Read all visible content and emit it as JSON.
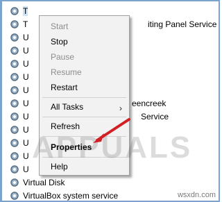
{
  "services": [
    {
      "label": "T",
      "selected": true
    },
    {
      "label": "T",
      "suffix": "iting Panel Service"
    },
    {
      "label": "U"
    },
    {
      "label": "U"
    },
    {
      "label": "U"
    },
    {
      "label": "U"
    },
    {
      "label": "U"
    },
    {
      "label": "U",
      "suffix": "eencreek"
    },
    {
      "label": "U",
      "suffix": "Service"
    },
    {
      "label": "U"
    },
    {
      "label": "U"
    },
    {
      "label": "U"
    },
    {
      "label": "U"
    },
    {
      "label": "Virtual Disk"
    },
    {
      "label": "VirtualBox system service"
    }
  ],
  "context_menu": {
    "start": "Start",
    "stop": "Stop",
    "pause": "Pause",
    "resume": "Resume",
    "restart": "Restart",
    "all_tasks": "All Tasks",
    "refresh": "Refresh",
    "properties": "Properties",
    "help": "Help"
  },
  "watermark": "APPUALS",
  "site": "wsxdn.com",
  "colors": {
    "arrow": "#d21f24",
    "selection": "#cde3f8"
  }
}
